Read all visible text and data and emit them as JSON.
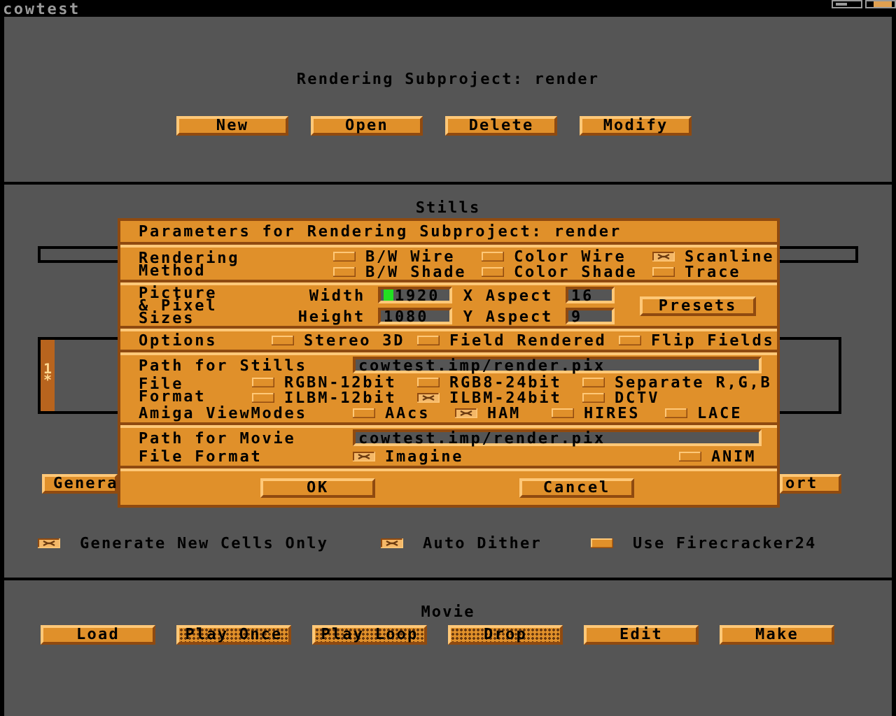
{
  "window": {
    "title": "cowtest"
  },
  "subproject": {
    "heading": "Rendering Subproject: render",
    "buttons": [
      {
        "label": "New",
        "disabled": false
      },
      {
        "label": "Open",
        "disabled": false
      },
      {
        "label": "Delete",
        "disabled": false
      },
      {
        "label": "Modify",
        "disabled": false
      }
    ]
  },
  "stills": {
    "heading": "Stills",
    "cell_list": {
      "marks": [
        "1",
        "*"
      ]
    },
    "buttons": [
      {
        "label": "Genera"
      },
      {
        "label": "ort"
      }
    ],
    "options": [
      {
        "label": "Generate New Cells Only",
        "checked": true
      },
      {
        "label": "Auto Dither",
        "checked": true
      },
      {
        "label": "Use Firecracker24",
        "checked": false
      }
    ]
  },
  "movie": {
    "heading": "Movie",
    "buttons": [
      {
        "label": "Load",
        "disabled": false
      },
      {
        "label": "Play Once",
        "disabled": true
      },
      {
        "label": "Play Loop",
        "disabled": true
      },
      {
        "label": "Drop",
        "disabled": true
      },
      {
        "label": "Edit",
        "disabled": false
      },
      {
        "label": "Make",
        "disabled": false
      }
    ]
  },
  "dialog": {
    "title": "Parameters for Rendering Subproject: render",
    "rendering_method": {
      "label": "Rendering Method",
      "options": [
        {
          "label": "B/W Wire",
          "selected": false
        },
        {
          "label": "Color Wire",
          "selected": false
        },
        {
          "label": "Scanline",
          "selected": true
        },
        {
          "label": "B/W Shade",
          "selected": false
        },
        {
          "label": "Color Shade",
          "selected": false
        },
        {
          "label": "Trace",
          "selected": false
        }
      ]
    },
    "sizes": {
      "label": "Picture & Pixel Sizes",
      "fields": [
        {
          "label": "Width",
          "value": "1920",
          "focused": true
        },
        {
          "label": "X Aspect",
          "value": "16",
          "focused": false
        },
        {
          "label": "Height",
          "value": "1080",
          "focused": false
        },
        {
          "label": "Y Aspect",
          "value": "9",
          "focused": false
        }
      ],
      "button": "Presets"
    },
    "options": {
      "label": "Options",
      "checks": [
        {
          "label": "Stereo 3D",
          "checked": false
        },
        {
          "label": "Field Rendered",
          "checked": false
        },
        {
          "label": "Flip Fields",
          "checked": false
        }
      ]
    },
    "stills_path": {
      "label": "Path for Stills",
      "value": "cowtest.imp/render.pix"
    },
    "file_format": {
      "label": "File Format",
      "options": [
        {
          "label": "RGBN-12bit",
          "selected": false
        },
        {
          "label": "RGB8-24bit",
          "selected": false
        },
        {
          "label": "Separate R,G,B",
          "selected": false
        },
        {
          "label": "ILBM-12bit",
          "selected": false
        },
        {
          "label": "ILBM-24bit",
          "selected": true
        },
        {
          "label": "DCTV",
          "selected": false
        }
      ]
    },
    "viewmodes": {
      "label": "Amiga ViewModes",
      "checks": [
        {
          "label": "AAcs",
          "checked": false
        },
        {
          "label": "HAM",
          "checked": true
        },
        {
          "label": "HIRES",
          "checked": false
        },
        {
          "label": "LACE",
          "checked": false
        }
      ]
    },
    "movie_path": {
      "label": "Path for Movie",
      "value": "cowtest.imp/render.pix"
    },
    "movie_format": {
      "label": "File Format",
      "options": [
        {
          "label": "Imagine",
          "selected": true
        },
        {
          "label": "ANIM",
          "selected": false
        }
      ]
    },
    "buttons": [
      {
        "label": "OK"
      },
      {
        "label": "Cancel"
      }
    ]
  }
}
